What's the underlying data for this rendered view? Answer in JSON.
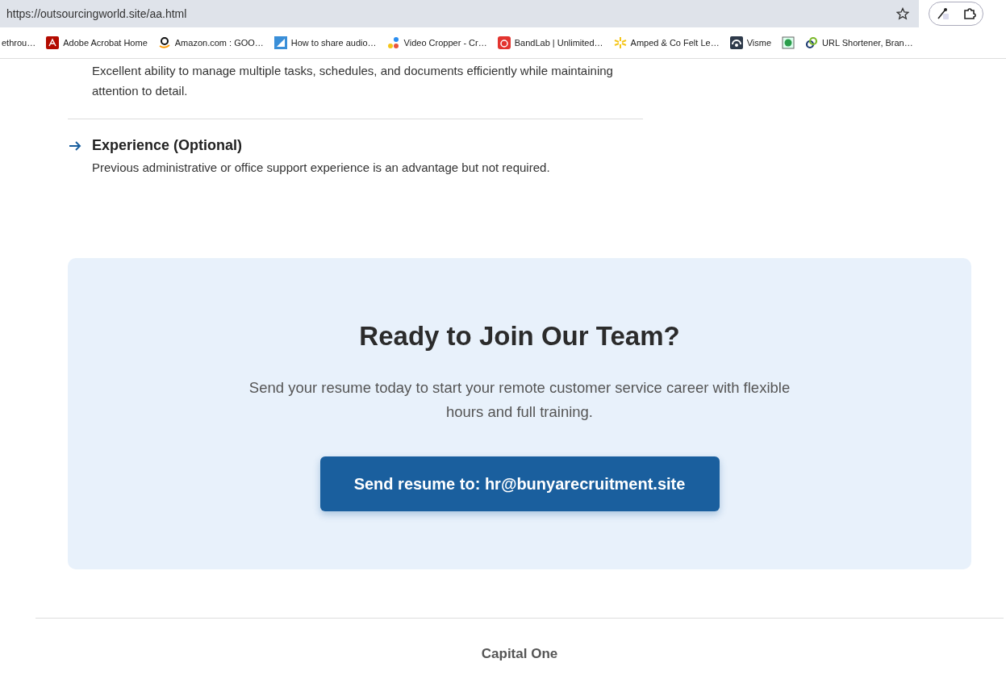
{
  "browser": {
    "url": "https://outsourcingworld.site/aa.html",
    "bookmarks": [
      {
        "label": "ethrou…",
        "kind": "none"
      },
      {
        "label": "Adobe Acrobat Home",
        "kind": "acrobat"
      },
      {
        "label": "Amazon.com : GOO…",
        "kind": "amazon"
      },
      {
        "label": "How to share audio…",
        "kind": "triangle"
      },
      {
        "label": "Video Cropper - Cr…",
        "kind": "dots"
      },
      {
        "label": "BandLab | Unlimited…",
        "kind": "bandlab"
      },
      {
        "label": "Amped & Co Felt Le…",
        "kind": "spark"
      },
      {
        "label": "Visme",
        "kind": "visme"
      },
      {
        "kind": "globe"
      },
      {
        "label": "URL Shortener, Bran…",
        "kind": "link"
      }
    ]
  },
  "requirements": [
    {
      "description": "Excellent ability to manage multiple tasks, schedules, and documents efficiently while maintaining attention to detail."
    },
    {
      "title": "Experience (Optional)",
      "description": "Previous administrative or office support experience is an advantage but not required."
    }
  ],
  "cta": {
    "heading": "Ready to Join Our Team?",
    "text": "Send your resume today to start your remote customer service career with flexible hours and full training.",
    "button": "Send resume to: hr@bunyarecruitment.site"
  },
  "footer": {
    "brand": "Capital One"
  }
}
